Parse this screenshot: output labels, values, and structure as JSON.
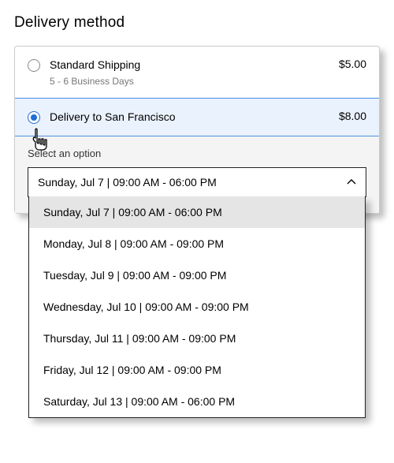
{
  "heading": "Delivery method",
  "options": [
    {
      "title": "Standard Shipping",
      "subtitle": "5 - 6 Business Days",
      "price": "$5.00"
    },
    {
      "title": "Delivery to San Francisco",
      "price": "$8.00"
    }
  ],
  "select": {
    "label": "Select an option",
    "selected": "Sunday, Jul 7 | 09:00 AM - 06:00 PM",
    "icon": "chevron-up-icon"
  },
  "dropdown_items": [
    "Sunday, Jul 7 | 09:00 AM - 06:00 PM",
    "Monday, Jul 8 | 09:00 AM - 09:00 PM",
    "Tuesday, Jul 9 | 09:00 AM - 09:00 PM",
    "Wednesday, Jul 10 | 09:00 AM - 09:00 PM",
    "Thursday, Jul 11 | 09:00 AM - 09:00 PM",
    "Friday, Jul 12 | 09:00 AM - 09:00 PM",
    "Saturday, Jul 13 | 09:00 AM - 06:00 PM"
  ]
}
